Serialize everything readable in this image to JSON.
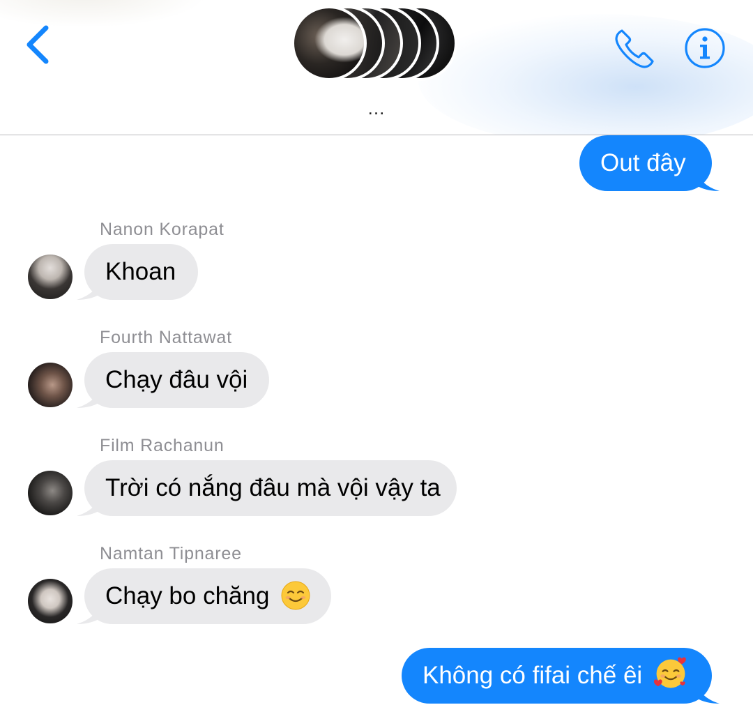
{
  "header": {
    "group_name": "...",
    "back_icon": "chevron-left-icon",
    "call_icon": "phone-icon",
    "info_icon": "info-circle-icon",
    "accent_color": "#1486fd"
  },
  "messages": [
    {
      "direction": "outgoing",
      "text": "Out đây"
    },
    {
      "direction": "incoming",
      "sender": "Nanon Korapat",
      "text": "Khoan"
    },
    {
      "direction": "incoming",
      "sender": "Fourth Nattawat",
      "text": "Chạy đâu vội"
    },
    {
      "direction": "incoming",
      "sender": "Film Rachanun",
      "text": "Trời có nắng đâu mà vội vậy ta"
    },
    {
      "direction": "incoming",
      "sender": "Namtan Tipnaree",
      "text": "Chạy bo chăng",
      "emoji": "smiling-face-icon"
    },
    {
      "direction": "outgoing",
      "text": "Không có fifai chế êi",
      "emoji": "smiling-face-with-hearts-icon"
    }
  ],
  "colors": {
    "outgoing_bubble": "#1486fd",
    "incoming_bubble": "#e9e9eb",
    "sender_name": "#8e8e93"
  }
}
